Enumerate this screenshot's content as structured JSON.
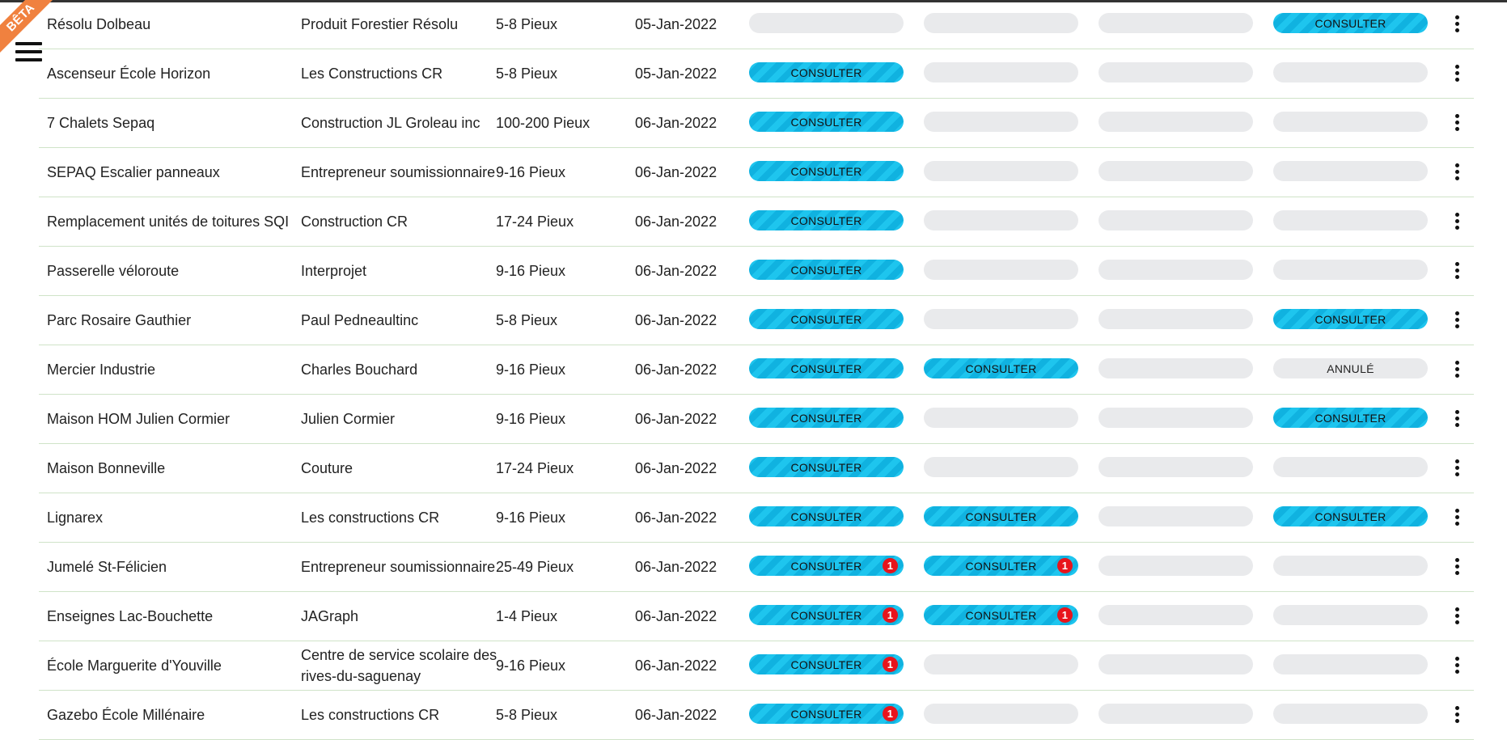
{
  "ribbon": "BÊTA",
  "rows": [
    {
      "name": "Résolu Dolbeau",
      "client": "Produit Forestier Résolu",
      "range": "5-8 Pieux",
      "date": "05-Jan-2022",
      "s": [
        "",
        "",
        "",
        "CONSULTER"
      ],
      "b": [
        "",
        "",
        "",
        ""
      ]
    },
    {
      "name": "Ascenseur École Horizon",
      "client": "Les Constructions CR",
      "range": "5-8 Pieux",
      "date": "05-Jan-2022",
      "s": [
        "CONSULTER",
        "",
        "",
        ""
      ],
      "b": [
        "",
        "",
        "",
        ""
      ]
    },
    {
      "name": "7 Chalets Sepaq",
      "client": "Construction JL Groleau inc",
      "range": "100-200 Pieux",
      "date": "06-Jan-2022",
      "s": [
        "CONSULTER",
        "",
        "",
        ""
      ],
      "b": [
        "",
        "",
        "",
        ""
      ]
    },
    {
      "name": "SEPAQ Escalier panneaux",
      "client": "Entrepreneur soumissionnaire",
      "range": "9-16 Pieux",
      "date": "06-Jan-2022",
      "s": [
        "CONSULTER",
        "",
        "",
        ""
      ],
      "b": [
        "",
        "",
        "",
        ""
      ]
    },
    {
      "name": "Remplacement unités de toitures SQI",
      "client": "Construction CR",
      "range": "17-24 Pieux",
      "date": "06-Jan-2022",
      "s": [
        "CONSULTER",
        "",
        "",
        ""
      ],
      "b": [
        "",
        "",
        "",
        ""
      ]
    },
    {
      "name": "Passerelle véloroute",
      "client": "Interprojet",
      "range": "9-16 Pieux",
      "date": "06-Jan-2022",
      "s": [
        "CONSULTER",
        "",
        "",
        ""
      ],
      "b": [
        "",
        "",
        "",
        ""
      ]
    },
    {
      "name": "Parc Rosaire Gauthier",
      "client": "Paul Pedneaultinc",
      "range": "5-8 Pieux",
      "date": "06-Jan-2022",
      "s": [
        "CONSULTER",
        "",
        "",
        "CONSULTER"
      ],
      "b": [
        "",
        "",
        "",
        ""
      ]
    },
    {
      "name": "Mercier Industrie",
      "client": "Charles Bouchard",
      "range": "9-16 Pieux",
      "date": "06-Jan-2022",
      "s": [
        "CONSULTER",
        "CONSULTER",
        "",
        "ANNULÉ"
      ],
      "b": [
        "",
        "",
        "",
        ""
      ]
    },
    {
      "name": "Maison HOM Julien Cormier",
      "client": "Julien Cormier",
      "range": "9-16 Pieux",
      "date": "06-Jan-2022",
      "s": [
        "CONSULTER",
        "",
        "",
        "CONSULTER"
      ],
      "b": [
        "",
        "",
        "",
        ""
      ]
    },
    {
      "name": "Maison Bonneville",
      "client": "Couture",
      "range": "17-24 Pieux",
      "date": "06-Jan-2022",
      "s": [
        "CONSULTER",
        "",
        "",
        ""
      ],
      "b": [
        "",
        "",
        "",
        ""
      ]
    },
    {
      "name": "Lignarex",
      "client": "Les constructions CR",
      "range": "9-16 Pieux",
      "date": "06-Jan-2022",
      "s": [
        "CONSULTER",
        "CONSULTER",
        "",
        "CONSULTER"
      ],
      "b": [
        "",
        "",
        "",
        ""
      ]
    },
    {
      "name": "Jumelé St-Félicien",
      "client": "Entrepreneur soumissionnaire",
      "range": "25-49 Pieux",
      "date": "06-Jan-2022",
      "s": [
        "CONSULTER",
        "CONSULTER",
        "",
        ""
      ],
      "b": [
        "1",
        "1",
        "",
        ""
      ]
    },
    {
      "name": "Enseignes Lac-Bouchette",
      "client": "JAGraph",
      "range": "1-4 Pieux",
      "date": "06-Jan-2022",
      "s": [
        "CONSULTER",
        "CONSULTER",
        "",
        ""
      ],
      "b": [
        "1",
        "1",
        "",
        ""
      ]
    },
    {
      "name": "École Marguerite d'Youville",
      "client": "Centre de service scolaire des rives-du-saguenay",
      "range": "9-16 Pieux",
      "date": "06-Jan-2022",
      "s": [
        "CONSULTER",
        "",
        "",
        ""
      ],
      "b": [
        "1",
        "",
        "",
        ""
      ]
    },
    {
      "name": "Gazebo École Millénaire",
      "client": "Les constructions CR",
      "range": "5-8 Pieux",
      "date": "06-Jan-2022",
      "s": [
        "CONSULTER",
        "",
        "",
        ""
      ],
      "b": [
        "1",
        "",
        "",
        ""
      ]
    }
  ]
}
